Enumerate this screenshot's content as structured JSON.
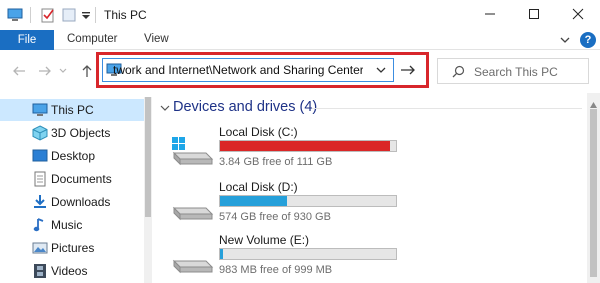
{
  "window": {
    "title": "This PC",
    "controls": {
      "minimize": "minimize-icon",
      "maximize": "maximize-icon",
      "close": "close-icon"
    }
  },
  "ribbon": {
    "file_tab": "File",
    "tabs": [
      "Computer",
      "View"
    ],
    "help_label": "?"
  },
  "navigation": {
    "address": "twork and Internet\\Network and Sharing Center",
    "search_placeholder": "Search This PC"
  },
  "sidebar": {
    "items": [
      {
        "label": "This PC",
        "icon": "computer-icon",
        "selected": true
      },
      {
        "label": "3D Objects",
        "icon": "cube-icon",
        "selected": false
      },
      {
        "label": "Desktop",
        "icon": "desktop-icon",
        "selected": false
      },
      {
        "label": "Documents",
        "icon": "documents-icon",
        "selected": false
      },
      {
        "label": "Downloads",
        "icon": "download-icon",
        "selected": false
      },
      {
        "label": "Music",
        "icon": "music-note-icon",
        "selected": false
      },
      {
        "label": "Pictures",
        "icon": "pictures-icon",
        "selected": false
      },
      {
        "label": "Videos",
        "icon": "film-icon",
        "selected": false
      }
    ]
  },
  "content": {
    "group_title": "Devices and drives (4)",
    "drives": [
      {
        "name": "Local Disk (C:)",
        "free_text": "3.84 GB free of 111 GB",
        "used_fraction": 0.965,
        "bar_color": "#da2626",
        "icon": "windows-drive-icon"
      },
      {
        "name": "Local Disk (D:)",
        "free_text": "574 GB free of 930 GB",
        "used_fraction": 0.383,
        "bar_color": "#26a0da",
        "icon": "drive-icon"
      },
      {
        "name": "New Volume (E:)",
        "free_text": "983 MB free of 999 MB",
        "used_fraction": 0.016,
        "bar_color": "#26a0da",
        "icon": "drive-icon"
      }
    ]
  },
  "colors": {
    "accent": "#1a6ec2",
    "highlight_border": "#d8262b",
    "selection": "#cce8ff",
    "group_title": "#1e3287"
  }
}
